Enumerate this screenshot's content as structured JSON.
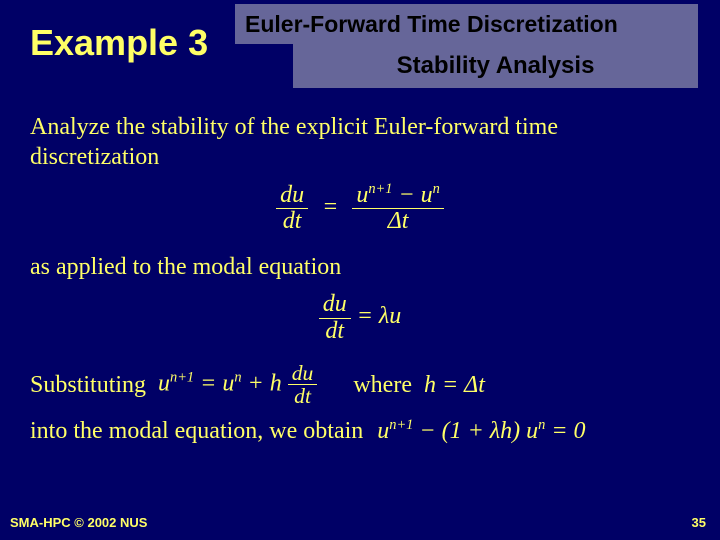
{
  "header": {
    "example": "Example 3",
    "title": "Euler-Forward Time Discretization",
    "subtitle": "Stability Analysis"
  },
  "body": {
    "p1": "Analyze the stability of the explicit Euler-forward time discretization",
    "eq1": {
      "lhs_num": "du",
      "lhs_den": "dt",
      "eq": "=",
      "rhs_num": "u",
      "rhs_sup1": "n+1",
      "minus": " − ",
      "rhs_u2": "u",
      "rhs_sup2": "n",
      "rhs_den": "Δt"
    },
    "p2": "as applied to the modal equation",
    "eq2": {
      "lhs_num": "du",
      "lhs_den": "dt",
      "eq": " = ",
      "rhs": "λu"
    },
    "sub_label": "Substituting",
    "eq3": {
      "u1": "u",
      "sup1": "n+1",
      "eq": " = ",
      "u2": "u",
      "sup2": "n",
      "plus": " + h ",
      "frac_num": "du",
      "frac_den": "dt"
    },
    "where_label": "where",
    "eq4": {
      "text": "h = Δt"
    },
    "p3": "into the modal equation, we obtain",
    "eq5": {
      "u1": "u",
      "sup1": "n+1",
      "minus": " − (1 + λh) ",
      "u2": "u",
      "sup2": "n",
      "eq0": " = 0"
    }
  },
  "footer": {
    "left": "SMA-HPC © 2002 NUS",
    "right": "35"
  }
}
